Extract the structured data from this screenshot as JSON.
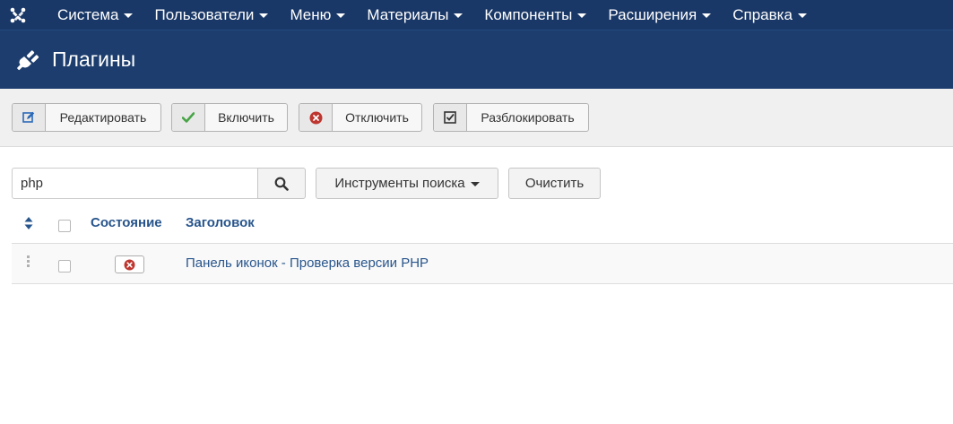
{
  "topnav": {
    "logo_icon": "joomla-logo-icon",
    "items": [
      {
        "label": "Система"
      },
      {
        "label": "Пользователи"
      },
      {
        "label": "Меню"
      },
      {
        "label": "Материалы"
      },
      {
        "label": "Компоненты"
      },
      {
        "label": "Расширения"
      },
      {
        "label": "Справка"
      }
    ]
  },
  "header": {
    "icon": "plug-icon",
    "title": "Плагины"
  },
  "toolbar": {
    "edit_label": "Редактировать",
    "enable_label": "Включить",
    "disable_label": "Отключить",
    "unlock_label": "Разблокировать"
  },
  "search": {
    "value": "php",
    "placeholder": "",
    "tools_label": "Инструменты поиска",
    "clear_label": "Очистить"
  },
  "table": {
    "columns": {
      "status": "Состояние",
      "title": "Заголовок"
    },
    "rows": [
      {
        "title": "Панель иконок - Проверка версии PHP",
        "state": "disabled"
      }
    ]
  },
  "colors": {
    "nav_bg": "#1a3867",
    "header_bg": "#1c3d6d",
    "link": "#28558c",
    "enable_green": "#46a546",
    "disable_red": "#bd362f",
    "edit_blue": "#2a69b8"
  }
}
